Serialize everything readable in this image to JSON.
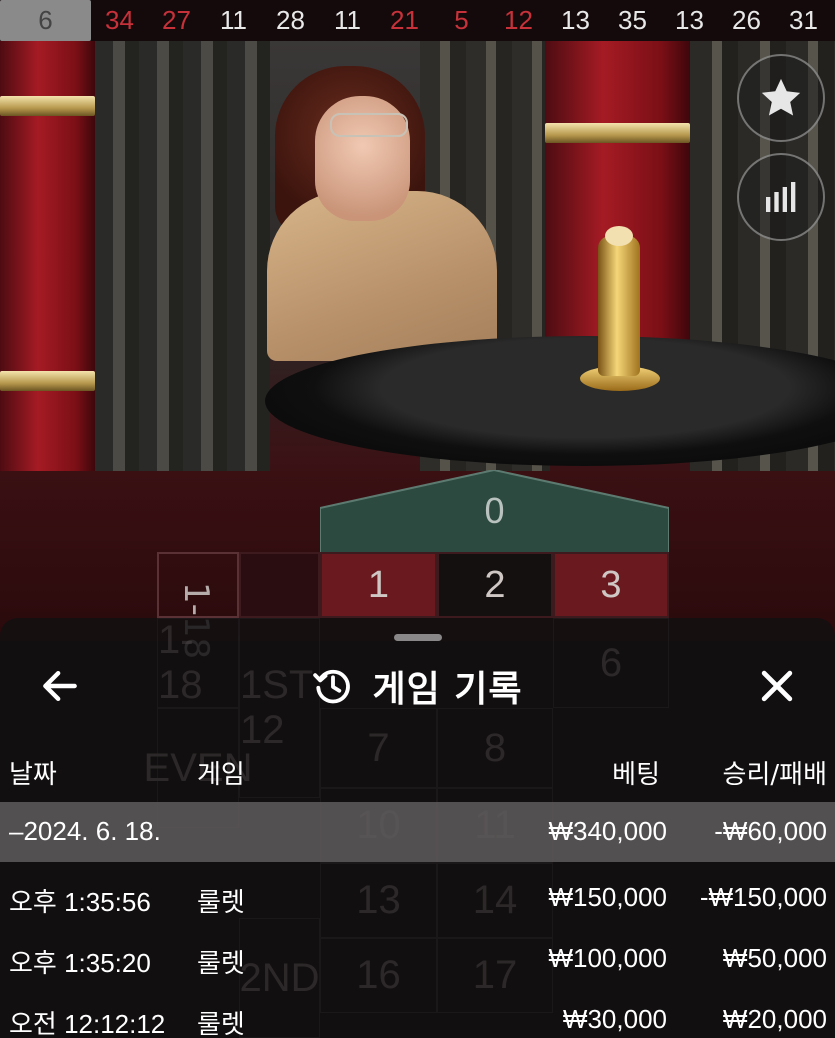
{
  "results_strip": [
    {
      "value": "6",
      "color": "highlight"
    },
    {
      "value": "34",
      "color": "red"
    },
    {
      "value": "27",
      "color": "red"
    },
    {
      "value": "11",
      "color": "black"
    },
    {
      "value": "28",
      "color": "black"
    },
    {
      "value": "11",
      "color": "black"
    },
    {
      "value": "21",
      "color": "red"
    },
    {
      "value": "5",
      "color": "red"
    },
    {
      "value": "12",
      "color": "red"
    },
    {
      "value": "13",
      "color": "black"
    },
    {
      "value": "35",
      "color": "black"
    },
    {
      "value": "13",
      "color": "black"
    },
    {
      "value": "26",
      "color": "black"
    },
    {
      "value": "31",
      "color": "black"
    }
  ],
  "side_buttons": {
    "favorite_icon": "star-icon",
    "stats_icon": "statistics-bars-icon"
  },
  "betting_grid": {
    "zero": "0",
    "row1": [
      "1",
      "2",
      "3"
    ],
    "side_label": "1-18"
  },
  "ghost_grid": {
    "numbers": [
      "6",
      "7",
      "8",
      "10",
      "11",
      "13",
      "14",
      "16",
      "17"
    ],
    "labels": [
      "1-18",
      "1ST 12",
      "EVEN",
      "2ND"
    ]
  },
  "history": {
    "title": "게임 기록",
    "title_icon": "history-clock-icon",
    "back_icon": "back-arrow-icon",
    "close_icon": "close-icon",
    "columns": {
      "date": "날짜",
      "game": "게임",
      "bet": "베팅",
      "win_loss": "승리/패배"
    },
    "date_group": {
      "date": "–2024. 6. 18.",
      "bet": "₩340,000",
      "win_loss": "-₩60,000"
    },
    "rows": [
      {
        "time": "오후 1:35:56",
        "game": "룰렛",
        "bet": "₩150,000",
        "win_loss": "-₩150,000"
      },
      {
        "time": "오후 1:35:20",
        "game": "룰렛",
        "bet": "₩100,000",
        "win_loss": "₩50,000"
      },
      {
        "time": "오전 12:12:12",
        "game": "룰렛",
        "bet": "₩30,000",
        "win_loss": "₩20,000"
      }
    ]
  },
  "colors": {
    "red_number": "#c6313a",
    "zero_green": "#2c4a40",
    "red_cell": "#6a1a1f",
    "sheet_bg": "#121011"
  }
}
